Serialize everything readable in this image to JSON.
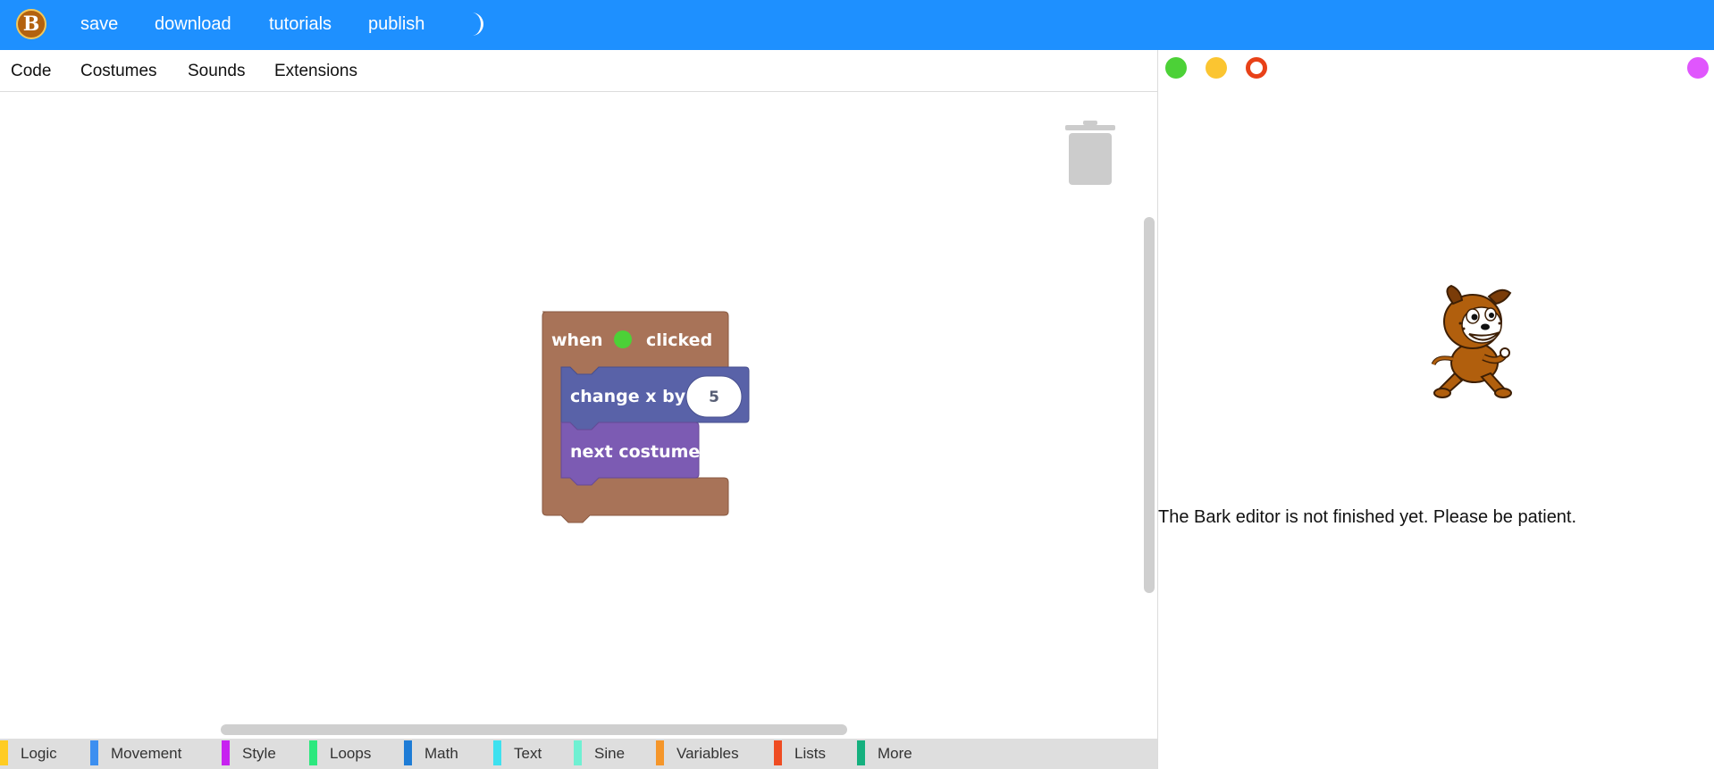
{
  "header": {
    "logo_letter": "B",
    "nav": [
      "save",
      "download",
      "tutorials",
      "publish"
    ],
    "theme_toggle_icon": "moon-icon"
  },
  "tabs": [
    "Code",
    "Costumes",
    "Sounds",
    "Extensions"
  ],
  "blocks": {
    "event": {
      "when": "when",
      "flag_icon": "green-flag-icon",
      "clicked": "clicked",
      "color": "#a87358"
    },
    "move": {
      "label": "change x by",
      "value": "5",
      "color": "#5962a8"
    },
    "looks": {
      "label": "next costume",
      "color": "#7c5bb3"
    }
  },
  "categories": [
    {
      "label": "Logic",
      "color": "#ffcc22"
    },
    {
      "label": "Movement",
      "color": "#3d8ff0"
    },
    {
      "label": "Style",
      "color": "#c722f0"
    },
    {
      "label": "Loops",
      "color": "#2ce87e"
    },
    {
      "label": "Math",
      "color": "#1e7cd6"
    },
    {
      "label": "Text",
      "color": "#3ee1ef"
    },
    {
      "label": "Sine",
      "color": "#6ff0d2"
    },
    {
      "label": "Variables",
      "color": "#f5962a"
    },
    {
      "label": "Lists",
      "color": "#ef4c22"
    },
    {
      "label": "More",
      "color": "#15b07e"
    }
  ],
  "stage": {
    "controls": [
      {
        "name": "green-flag-button",
        "color": "#4cd137"
      },
      {
        "name": "pause-button",
        "color": "#fbc531"
      },
      {
        "name": "stop-button",
        "color": "#e84118"
      }
    ],
    "extra_button_color": "#e056fd",
    "sprite_icon": "dog-sprite",
    "notice": "The Bark editor is not finished yet. Please be patient."
  },
  "colors": {
    "accent": "#1e90ff",
    "trash": "#cccccc"
  }
}
